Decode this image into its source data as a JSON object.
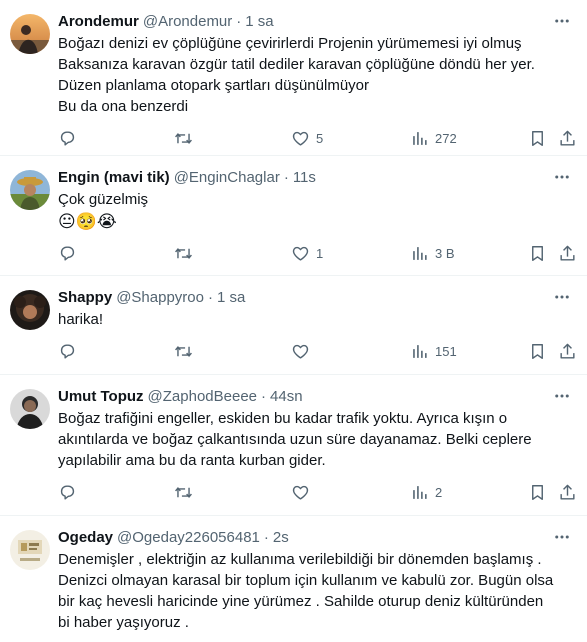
{
  "tweets": [
    {
      "name": "Arondemur",
      "handle": "@Arondemur",
      "time": "1 sa",
      "text": "Boğazı denizi ev çöplüğüne çevirirlerdi Projenin yürümemesi iyi olmuş\nBaksanıza karavan özgür tatil dediler karavan çöplüğüne döndü her yer.\nDüzen planlama otopark şartları düşünülmüyor\nBu da ona benzerdi",
      "emojis": "",
      "likes": "5",
      "views": "272"
    },
    {
      "name": "Engin (mavi tik)",
      "handle": "@EnginChaglar",
      "time": "11s",
      "text": "Çok güzelmiş",
      "emojis": "😐🥺😭",
      "likes": "1",
      "views": "3 B"
    },
    {
      "name": "Shappy",
      "handle": "@Shappyroo",
      "time": "1 sa",
      "text": "harika!",
      "emojis": "",
      "likes": "",
      "views": "151"
    },
    {
      "name": "Umut Topuz",
      "handle": "@ZaphodBeeee",
      "time": "44sn",
      "text": "Boğaz trafiğini engeller, eskiden bu kadar trafik yoktu. Ayrıca kışın o\nakıntılarda ve boğaz çalkantısında uzun süre dayanamaz. Belki ceplere\nyapılabilir ama bu da ranta kurban gider.",
      "emojis": "",
      "likes": "",
      "views": "2"
    },
    {
      "name": "Ogeday",
      "handle": "@Ogeday226056481",
      "time": "2s",
      "text": "Denemişler , elektriğin az kullanıma verilebildiği bir dönemden başlamış .\nDenizci olmayan karasal bir toplum için kullanım ve kabulü zor. Bugün olsa\nbir kaç hevesli haricinde yine yürümez . Sahilde oturup deniz kültüründen\nbi haber yaşıyoruz .",
      "emojis": "",
      "likes": "",
      "views": ""
    }
  ],
  "separator": "·",
  "icons": {
    "more": "more-dots-icon",
    "reply": "reply-icon",
    "retweet": "retweet-icon",
    "like": "heart-icon",
    "views": "views-chart-icon",
    "bookmark": "bookmark-icon",
    "share": "share-icon"
  },
  "colors": {
    "text": "#0f1419",
    "secondary": "#536471",
    "divider": "#eff3f4"
  }
}
